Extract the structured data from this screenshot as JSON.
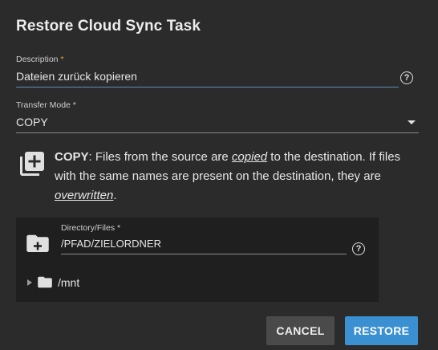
{
  "dialog": {
    "title": "Restore Cloud Sync Task"
  },
  "description": {
    "label": "Description",
    "required_mark": "*",
    "value": "Dateien zurück kopieren",
    "help_icon": "help-circle-icon"
  },
  "transfer_mode": {
    "label": "Transfer Mode *",
    "value": "COPY",
    "arrow_icon": "arrow-drop-down-icon"
  },
  "mode_info": {
    "icon": "library-add-icon",
    "mode": "COPY",
    "part1": ": Files from the source are ",
    "em1": "copied",
    "part2": " to the destination. If files with the same names are present on the destination, they are ",
    "em2": "overwritten",
    "part3": "."
  },
  "explorer": {
    "add_folder_icon": "create-new-folder-icon",
    "path_label": "Directory/Files *",
    "path_value": "/PFAD/ZIELORDNER",
    "help_icon": "help-circle-icon",
    "tree": [
      {
        "label": "/mnt",
        "icon": "folder-icon",
        "expanded": false
      }
    ]
  },
  "actions": {
    "cancel_label": "CANCEL",
    "restore_label": "RESTORE",
    "restore_color": "#3b90d1"
  }
}
